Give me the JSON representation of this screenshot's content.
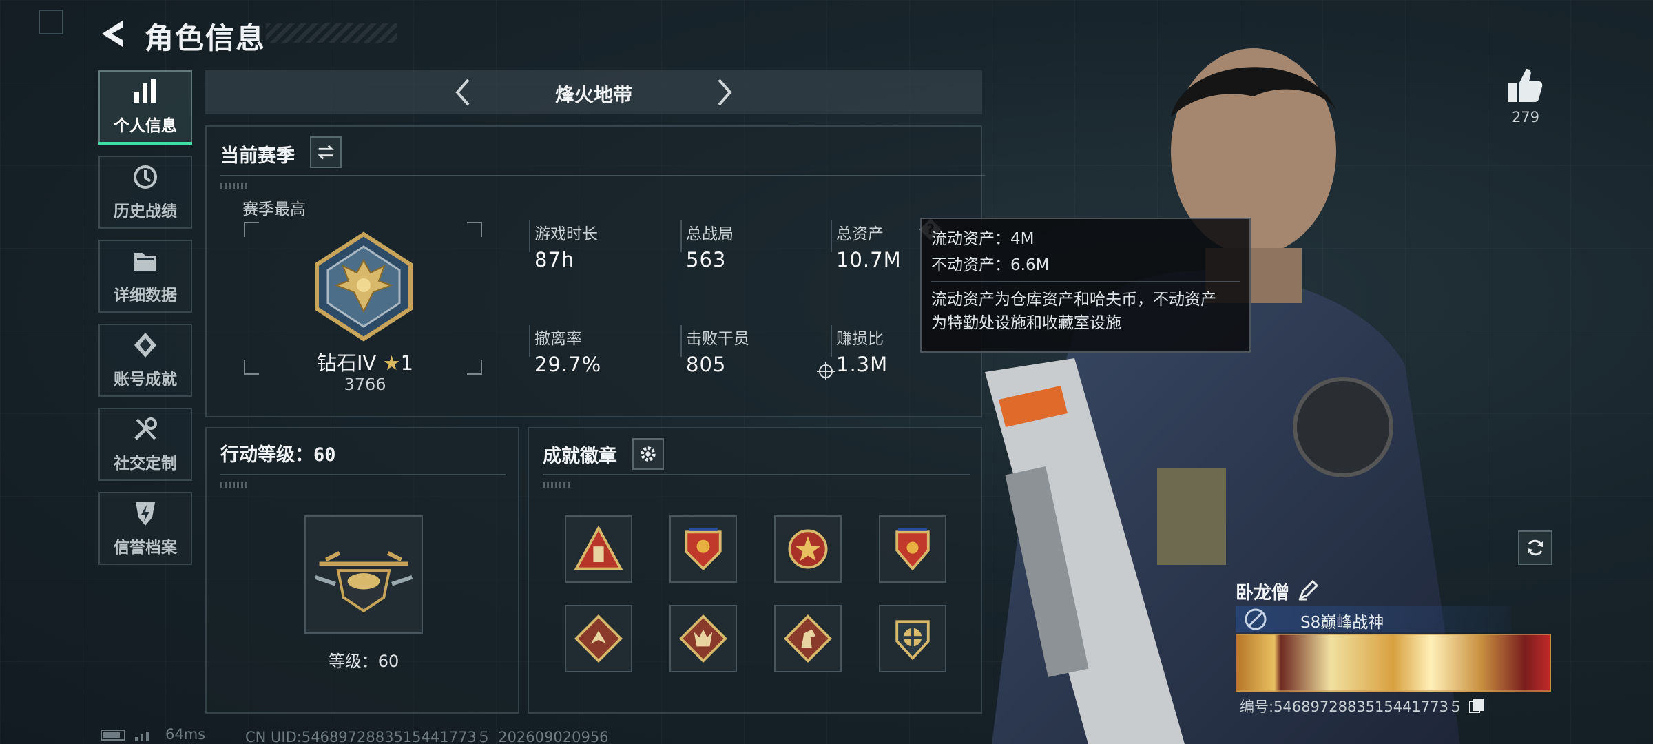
{
  "header": {
    "title": "角色信息"
  },
  "sidebar": {
    "items": [
      {
        "label": "个人信息",
        "icon": "bar-chart-icon"
      },
      {
        "label": "历史战绩",
        "icon": "clock-icon"
      },
      {
        "label": "详细数据",
        "icon": "folder-icon"
      },
      {
        "label": "账号成就",
        "icon": "achievement-icon"
      },
      {
        "label": "社交定制",
        "icon": "wrench-icon"
      },
      {
        "label": "信誉档案",
        "icon": "shield-icon"
      }
    ]
  },
  "mode": {
    "name": "烽火地带"
  },
  "season": {
    "title": "当前赛季",
    "best_label": "赛季最高",
    "rank_name": "钻石IV",
    "rank_stars": "1",
    "rank_score": "3766",
    "stats": [
      {
        "label": "游戏时长",
        "value": "87h"
      },
      {
        "label": "总战局",
        "value": "563"
      },
      {
        "label": "总资产",
        "value": "10.7M"
      },
      {
        "label": "撤离率",
        "value": "29.7%"
      },
      {
        "label": "击败干员",
        "value": "805"
      },
      {
        "label": "赚损比",
        "value": "1.3M"
      }
    ]
  },
  "tooltip": {
    "liquid": "流动资产：4M",
    "fixed": "不动资产：6.6M",
    "desc_line1": "流动资产为仓库资产和哈夫币，不动资产",
    "desc_line2": "为特勤处设施和收藏室设施"
  },
  "action_level": {
    "title": "行动等级：60",
    "level_text": "等级：60"
  },
  "achievements": {
    "title": "成就徽章"
  },
  "likes": {
    "count": "279"
  },
  "player": {
    "name": "卧龙僧",
    "title": "S8巅峰战神",
    "id_text": "编号:5468972883515441773５"
  },
  "footer": {
    "ping": "64ms",
    "uid": "CN UID:5468972883515441773５_202609020956"
  },
  "colors": {
    "accent": "#3de0a0",
    "gold": "#c8a45a"
  }
}
